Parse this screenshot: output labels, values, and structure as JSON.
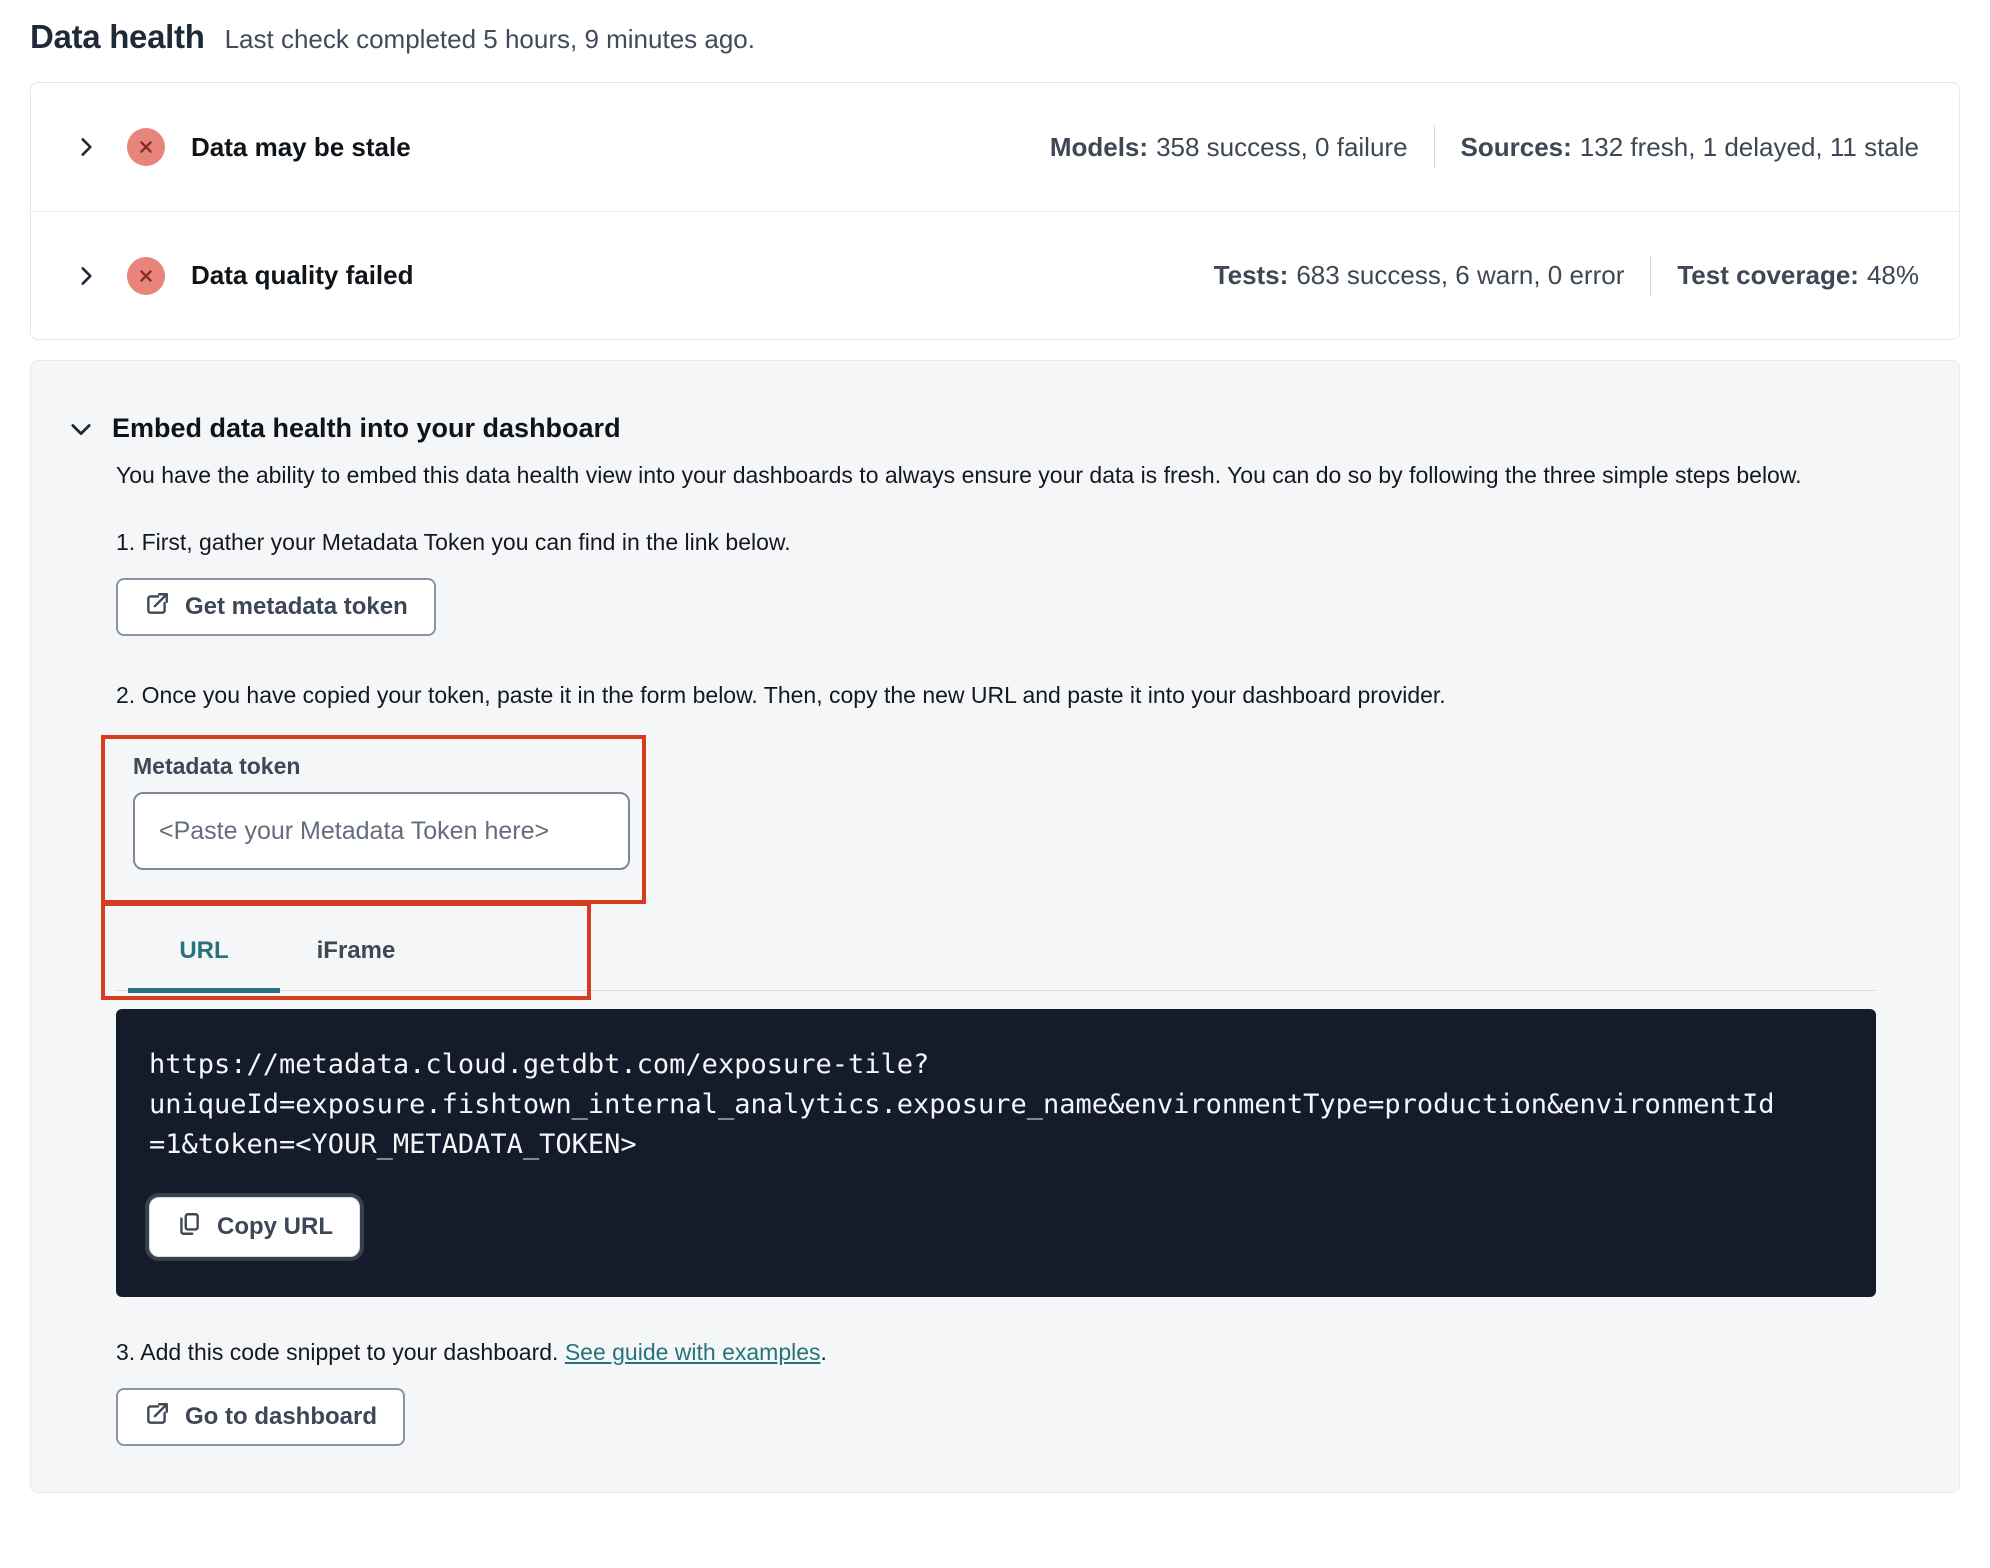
{
  "page": {
    "title": "Data health",
    "subtitle": "Last check completed 5 hours, 9 minutes ago."
  },
  "status_rows": [
    {
      "label": "Data may be stale",
      "status_icon": "error-x-circle",
      "stats": [
        {
          "label": "Models:",
          "value": "358 success, 0 failure"
        },
        {
          "label": "Sources:",
          "value": "132 fresh, 1 delayed, 11 stale"
        }
      ]
    },
    {
      "label": "Data quality failed",
      "status_icon": "error-x-circle",
      "stats": [
        {
          "label": "Tests:",
          "value": "683 success, 6 warn, 0 error"
        },
        {
          "label": "Test coverage:",
          "value": "48%"
        }
      ]
    }
  ],
  "embed": {
    "title": "Embed data health into your dashboard",
    "description": "You have the ability to embed this data health view into your dashboards to always ensure your data is fresh. You can do so by following the three simple steps below.",
    "step1": "1. First, gather your Metadata Token you can find in the link below.",
    "get_token_button": "Get metadata token",
    "step2": "2. Once you have copied your token, paste it in the form below. Then, copy the new URL and paste it into your dashboard provider.",
    "token_field": {
      "label": "Metadata token",
      "value": "",
      "placeholder": "<Paste your Metadata Token here>"
    },
    "tabs": [
      {
        "label": "URL",
        "active": true
      },
      {
        "label": "iFrame",
        "active": false
      }
    ],
    "code_lines": [
      "https://metadata.cloud.getdbt.com/exposure-tile?",
      "uniqueId=exposure.fishtown_internal_analytics.exposure_name&environmentType=production&environmentId",
      "=1&token=<YOUR_METADATA_TOKEN>"
    ],
    "copy_button": "Copy URL",
    "step3_prefix": "3. Add this code snippet to your dashboard. ",
    "step3_link": "See guide with examples",
    "step3_suffix": ".",
    "dashboard_button": "Go to dashboard"
  },
  "colors": {
    "accent_teal": "#26737B",
    "error_badge": "#E8847B",
    "error_badge_glyph": "#7F2F28",
    "annotation_red": "#D63C1F",
    "code_background": "#141B2B",
    "panel_background": "#F5F6F8"
  }
}
